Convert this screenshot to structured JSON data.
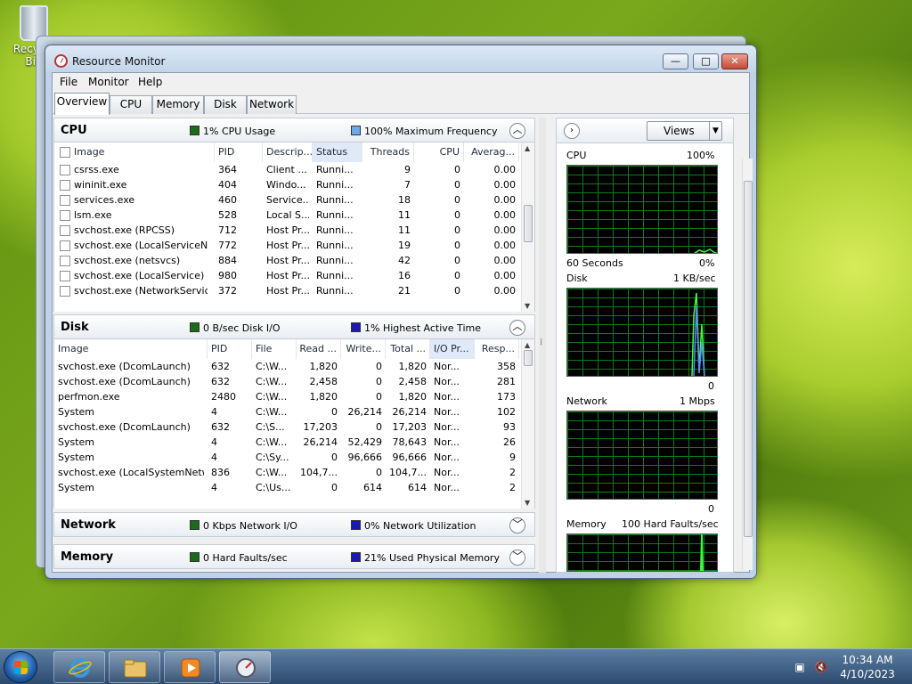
{
  "desktop": {
    "recycle_label": "Recycle Bin"
  },
  "window": {
    "title": "Resource Monitor",
    "minimize": "—",
    "maximize": "□",
    "close": "✕"
  },
  "menu": [
    "File",
    "Monitor",
    "Help"
  ],
  "tabs": [
    "Overview",
    "CPU",
    "Memory",
    "Disk",
    "Network"
  ],
  "cpu": {
    "title": "CPU",
    "legend1": "1% CPU Usage",
    "legend1_color": "#1a6b1a",
    "legend2": "100% Maximum Frequency",
    "legend2_color": "#6fa8e8",
    "columns": [
      "Image",
      "PID",
      "Descrip...",
      "Status",
      "Threads",
      "CPU",
      "Averag..."
    ],
    "rows": [
      [
        "csrss.exe",
        "364",
        "Client ...",
        "Runni...",
        "9",
        "0",
        "0.00"
      ],
      [
        "wininit.exe",
        "404",
        "Windo...",
        "Runni...",
        "7",
        "0",
        "0.00"
      ],
      [
        "services.exe",
        "460",
        "Service...",
        "Runni...",
        "18",
        "0",
        "0.00"
      ],
      [
        "lsm.exe",
        "528",
        "Local S...",
        "Runni...",
        "11",
        "0",
        "0.00"
      ],
      [
        "svchost.exe (RPCSS)",
        "712",
        "Host Pr...",
        "Runni...",
        "11",
        "0",
        "0.00"
      ],
      [
        "svchost.exe (LocalServiceNet...",
        "772",
        "Host Pr...",
        "Runni...",
        "19",
        "0",
        "0.00"
      ],
      [
        "svchost.exe (netsvcs)",
        "884",
        "Host Pr...",
        "Runni...",
        "42",
        "0",
        "0.00"
      ],
      [
        "svchost.exe (LocalService)",
        "980",
        "Host Pr...",
        "Runni...",
        "16",
        "0",
        "0.00"
      ],
      [
        "svchost.exe (NetworkService)",
        "372",
        "Host Pr...",
        "Runni...",
        "21",
        "0",
        "0.00"
      ]
    ]
  },
  "disk": {
    "title": "Disk",
    "legend1": "0 B/sec Disk I/O",
    "legend1_color": "#1a6b1a",
    "legend2": "1% Highest Active Time",
    "legend2_color": "#1a1ab0",
    "columns": [
      "Image",
      "PID",
      "File",
      "Read ...",
      "Write...",
      "Total ...",
      "I/O Pr...",
      "Resp..."
    ],
    "rows": [
      [
        "svchost.exe (DcomLaunch)",
        "632",
        "C:\\W...",
        "1,820",
        "0",
        "1,820",
        "Nor...",
        "358"
      ],
      [
        "svchost.exe (DcomLaunch)",
        "632",
        "C:\\W...",
        "2,458",
        "0",
        "2,458",
        "Nor...",
        "281"
      ],
      [
        "perfmon.exe",
        "2480",
        "C:\\W...",
        "1,820",
        "0",
        "1,820",
        "Nor...",
        "173"
      ],
      [
        "System",
        "4",
        "C:\\W...",
        "0",
        "26,214",
        "26,214",
        "Nor...",
        "102"
      ],
      [
        "svchost.exe (DcomLaunch)",
        "632",
        "C:\\S...",
        "17,203",
        "0",
        "17,203",
        "Nor...",
        "93"
      ],
      [
        "System",
        "4",
        "C:\\W...",
        "26,214",
        "52,429",
        "78,643",
        "Nor...",
        "26"
      ],
      [
        "System",
        "4",
        "C:\\Sy...",
        "0",
        "96,666",
        "96,666",
        "Nor...",
        "9"
      ],
      [
        "svchost.exe (LocalSystemNetw...",
        "836",
        "C:\\W...",
        "104,7...",
        "0",
        "104,7...",
        "Nor...",
        "2"
      ],
      [
        "System",
        "4",
        "C:\\Us...",
        "0",
        "614",
        "614",
        "Nor...",
        "2"
      ]
    ]
  },
  "network": {
    "title": "Network",
    "legend1": "0 Kbps Network I/O",
    "legend1_color": "#1a6b1a",
    "legend2": "0% Network Utilization",
    "legend2_color": "#1a1ab0"
  },
  "memory": {
    "title": "Memory",
    "legend1": "0 Hard Faults/sec",
    "legend1_color": "#1a6b1a",
    "legend2": "21% Used Physical Memory",
    "legend2_color": "#1a1ab0"
  },
  "right": {
    "views_label": "Views",
    "cpu_graph": {
      "label": "CPU",
      "max": "100%",
      "time": "60 Seconds",
      "min": "0%"
    },
    "disk_graph": {
      "label": "Disk",
      "max": "1 KB/sec",
      "min": "0"
    },
    "network_graph": {
      "label": "Network",
      "max": "1 Mbps",
      "min": "0"
    },
    "memory_graph": {
      "label": "Memory",
      "max": "100 Hard Faults/sec"
    }
  },
  "taskbar": {
    "time": "10:34 AM",
    "date": "4/10/2023"
  }
}
